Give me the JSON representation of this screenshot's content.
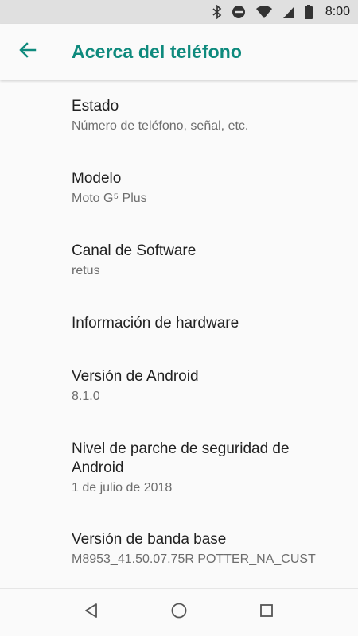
{
  "status_bar": {
    "time": "8:00",
    "icons": [
      "bluetooth-icon",
      "do-not-disturb-icon",
      "wifi-icon",
      "cell-signal-icon",
      "battery-icon"
    ]
  },
  "app_bar": {
    "title": "Acerca del teléfono",
    "back_icon": "arrow-left-icon"
  },
  "items": [
    {
      "title": "Estado",
      "subtitle": "Número de teléfono, señal, etc."
    },
    {
      "title": "Modelo",
      "subtitle": "Moto G⁵ Plus"
    },
    {
      "title": "Canal de Software",
      "subtitle": "retus"
    },
    {
      "title": "Información de hardware",
      "subtitle": ""
    },
    {
      "title": "Versión de Android",
      "subtitle": "8.1.0"
    },
    {
      "title": "Nivel de parche de seguridad de Android",
      "subtitle": "1 de julio de 2018"
    },
    {
      "title": "Versión de banda base",
      "subtitle": "M8953_41.50.07.75R POTTER_NA_CUST"
    }
  ],
  "nav_bar": {
    "icons": [
      "back-triangle-icon",
      "home-circle-icon",
      "recents-square-icon"
    ]
  },
  "colors": {
    "accent": "#0e8a7d",
    "status_bar": "#e0e0e0",
    "background": "#fafafa"
  }
}
